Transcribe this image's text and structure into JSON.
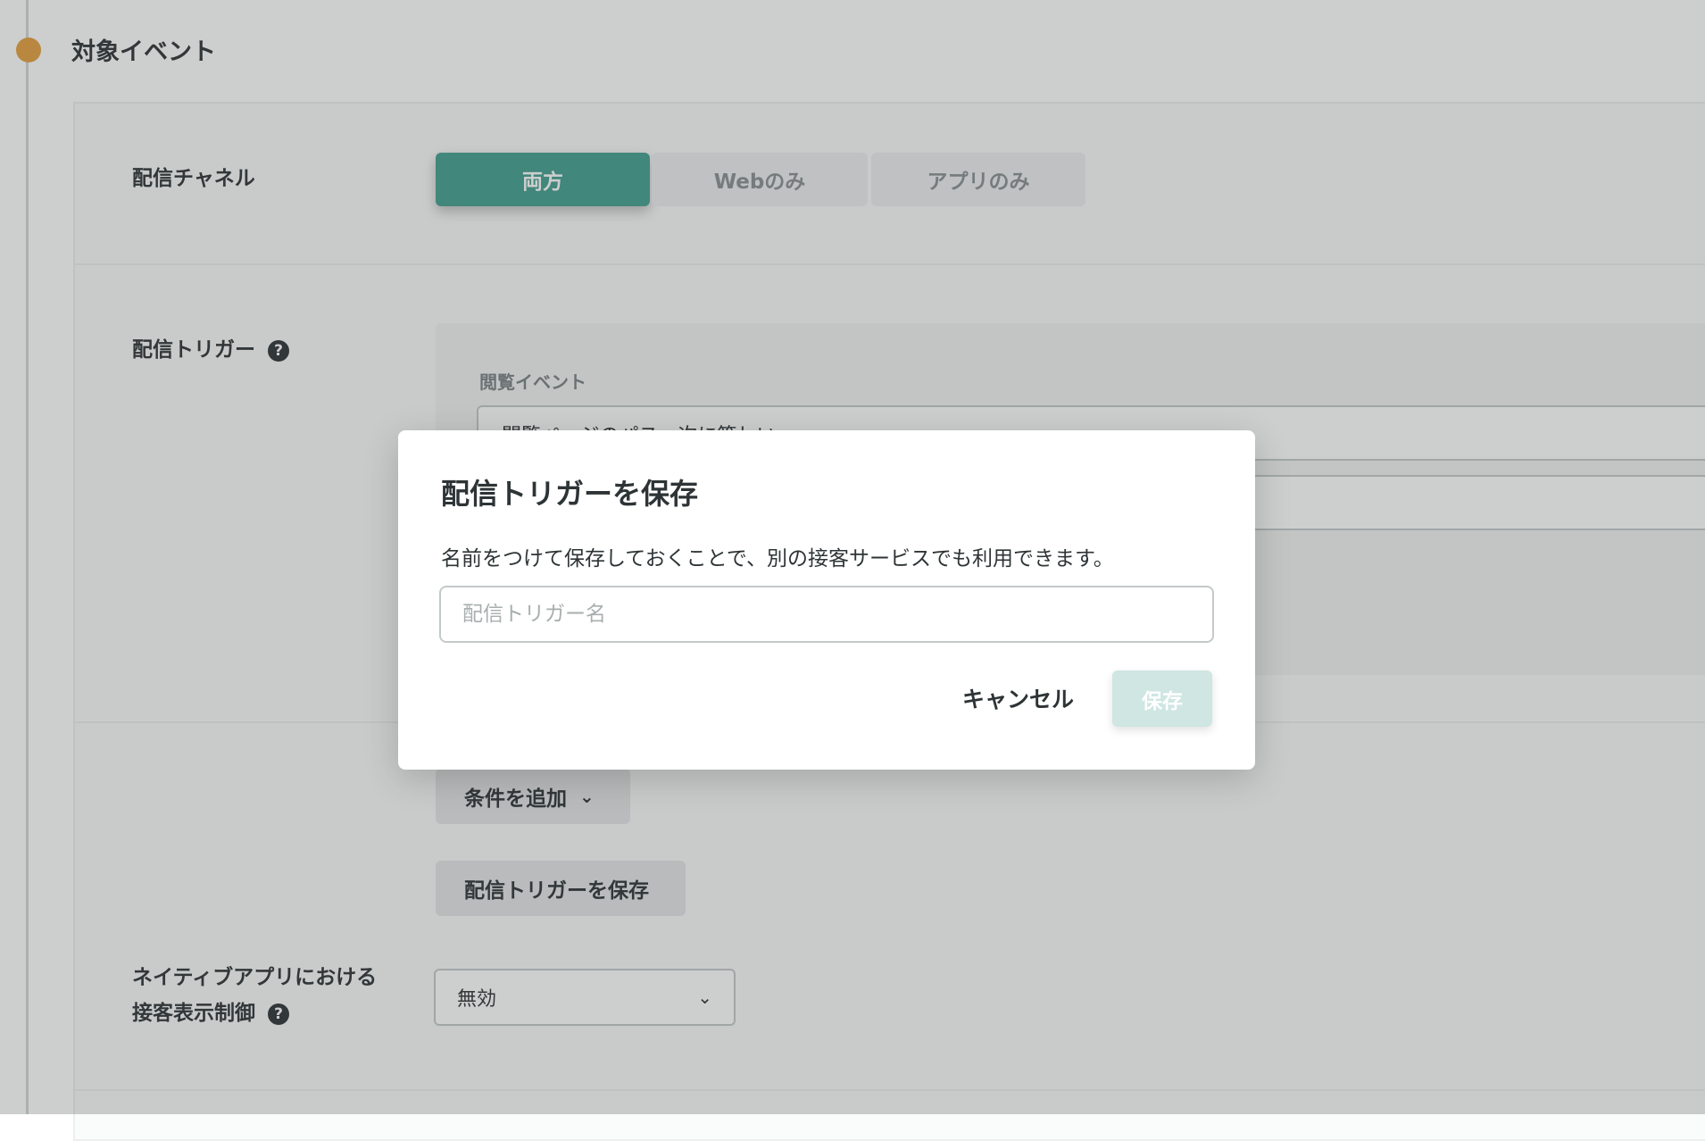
{
  "section": {
    "title": "対象イベント"
  },
  "channel": {
    "label": "配信チャネル",
    "options": [
      "両方",
      "Webのみ",
      "アプリのみ"
    ],
    "selected": "両方"
  },
  "trigger": {
    "label": "配信トリガー",
    "help": "?",
    "event_label": "閲覧イベント",
    "event_value": "閲覧ページのパス　次に等しい",
    "add_condition": "条件を追加",
    "save_trigger": "配信トリガーを保存"
  },
  "native": {
    "label_line1": "ネイティブアプリにおける",
    "label_line2": "接客表示制御",
    "help": "?",
    "select_value": "無効"
  },
  "modal": {
    "title": "配信トリガーを保存",
    "description": "名前をつけて保存しておくことで、別の接客サービスでも利用できます。",
    "input_placeholder": "配信トリガー名",
    "cancel": "キャンセル",
    "save": "保存"
  },
  "colors": {
    "accent": "#44a08f",
    "accent_disabled": "#cfe6e2",
    "timeline_dot": "#e5a03f"
  }
}
